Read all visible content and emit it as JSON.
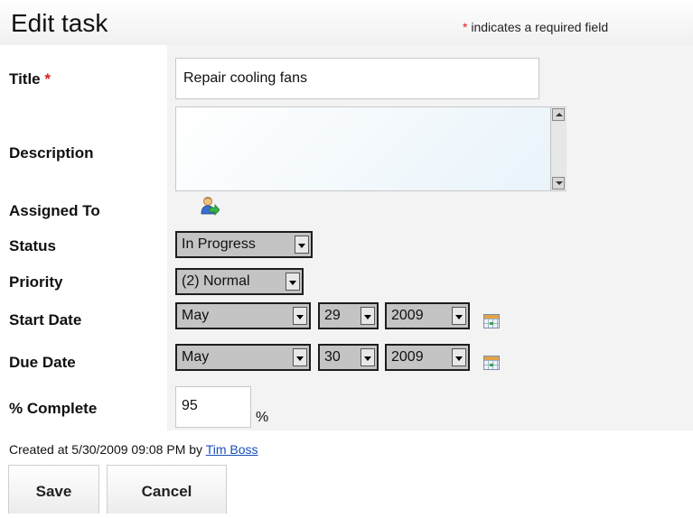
{
  "header": {
    "title": "Edit task",
    "required_star": "*",
    "required_text": "indicates a required field"
  },
  "fields": {
    "title": {
      "label": "Title",
      "required_star": "*",
      "value": "Repair cooling fans"
    },
    "description": {
      "label": "Description",
      "value": ""
    },
    "assigned_to": {
      "label": "Assigned To",
      "icon": "assign-user-icon"
    },
    "status": {
      "label": "Status",
      "value": "In Progress"
    },
    "priority": {
      "label": "Priority",
      "value": "(2) Normal"
    },
    "start_date": {
      "label": "Start Date",
      "month": "May",
      "day": "29",
      "year": "2009",
      "icon": "calendar-icon"
    },
    "due_date": {
      "label": "Due Date",
      "month": "May",
      "day": "30",
      "year": "2009",
      "icon": "calendar-icon"
    },
    "percent_complete": {
      "label": "% Complete",
      "value": "95",
      "unit": "%"
    }
  },
  "meta": {
    "created_text": "Created at 5/30/2009 09:08 PM by",
    "created_by": "Tim Boss"
  },
  "actions": {
    "save": "Save",
    "cancel": "Cancel"
  },
  "colors": {
    "required": "#e01c1c",
    "link": "#1a4fb8",
    "select_bg": "#c4c4c4",
    "form_bg": "#f3f3f3"
  }
}
